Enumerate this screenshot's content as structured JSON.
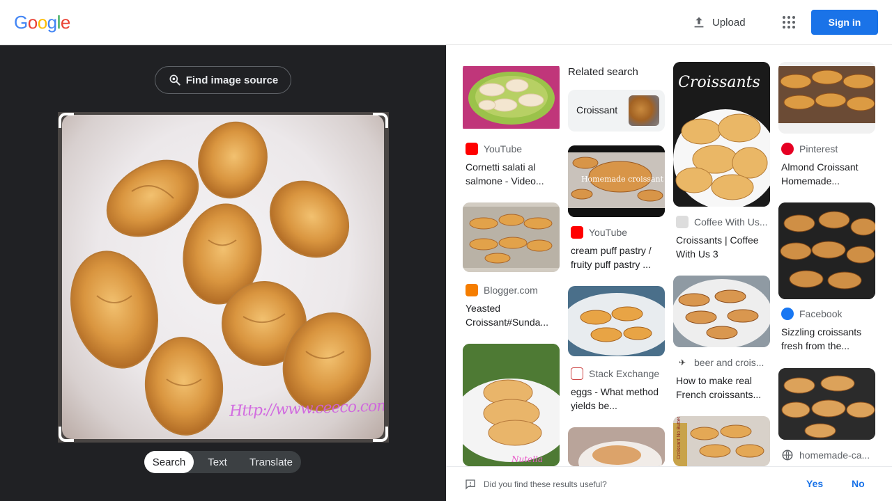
{
  "header": {
    "logo": {
      "letters": [
        "G",
        "o",
        "o",
        "g",
        "l",
        "e"
      ],
      "colors": [
        "#4285F4",
        "#EA4335",
        "#FBBC05",
        "#4285F4",
        "#34A853",
        "#EA4335"
      ]
    },
    "upload_label": "Upload",
    "signin_label": "Sign in",
    "icons": {
      "upload": "upload-icon",
      "apps": "apps-grid-icon"
    }
  },
  "left": {
    "find_source_label": "Find image source",
    "watermark": "Http://www.ceeco.com/hleandudy",
    "modes": [
      "Search",
      "Text",
      "Translate"
    ],
    "active_mode": "Search"
  },
  "related": {
    "title": "Related search",
    "chip_label": "Croissant"
  },
  "results": [
    {
      "source": "YouTube",
      "caption": "Cornetti salati al salmone - Video...",
      "icon": "youtube-icon"
    },
    {
      "source": "Blogger.com",
      "caption": "Yeasted Croissant#Sunda...",
      "icon": "blogger-icon"
    },
    {
      "source": "YouTube",
      "caption": "cream puff pastry / fruity puff pastry ...",
      "icon": "youtube-icon",
      "overlay": "Homemade croissant"
    },
    {
      "source": "Stack Exchange",
      "caption": "eggs - What method yields be...",
      "icon": "stack-exchange-icon"
    },
    {
      "source": "Coffee With Us...",
      "caption": "Croissants | Coffee With Us 3",
      "icon": "coffee-site-icon",
      "overlay": "Croissants"
    },
    {
      "source": "beer and crois...",
      "caption": "How to make real French croissants...",
      "icon": "beer-site-icon"
    },
    {
      "source": "Pinterest",
      "caption": "Almond Croissant Homemade...",
      "icon": "pinterest-icon"
    },
    {
      "source": "Facebook",
      "caption": "Sizzling croissants fresh from the...",
      "icon": "facebook-icon"
    },
    {
      "source": "homemade-ca...",
      "caption": "",
      "icon": "globe-icon"
    }
  ],
  "misc_overlays": {
    "nutella": "Nutella",
    "no_butter": "Croissant No Butter"
  },
  "feedback": {
    "question": "Did you find these results useful?",
    "yes": "Yes",
    "no": "No"
  },
  "colors": {
    "accent": "#1a73e8",
    "dark_panel": "#202124",
    "youtube": "#ff0000",
    "pinterest": "#e60023",
    "facebook": "#1877f2",
    "blogger": "#f57d00"
  }
}
